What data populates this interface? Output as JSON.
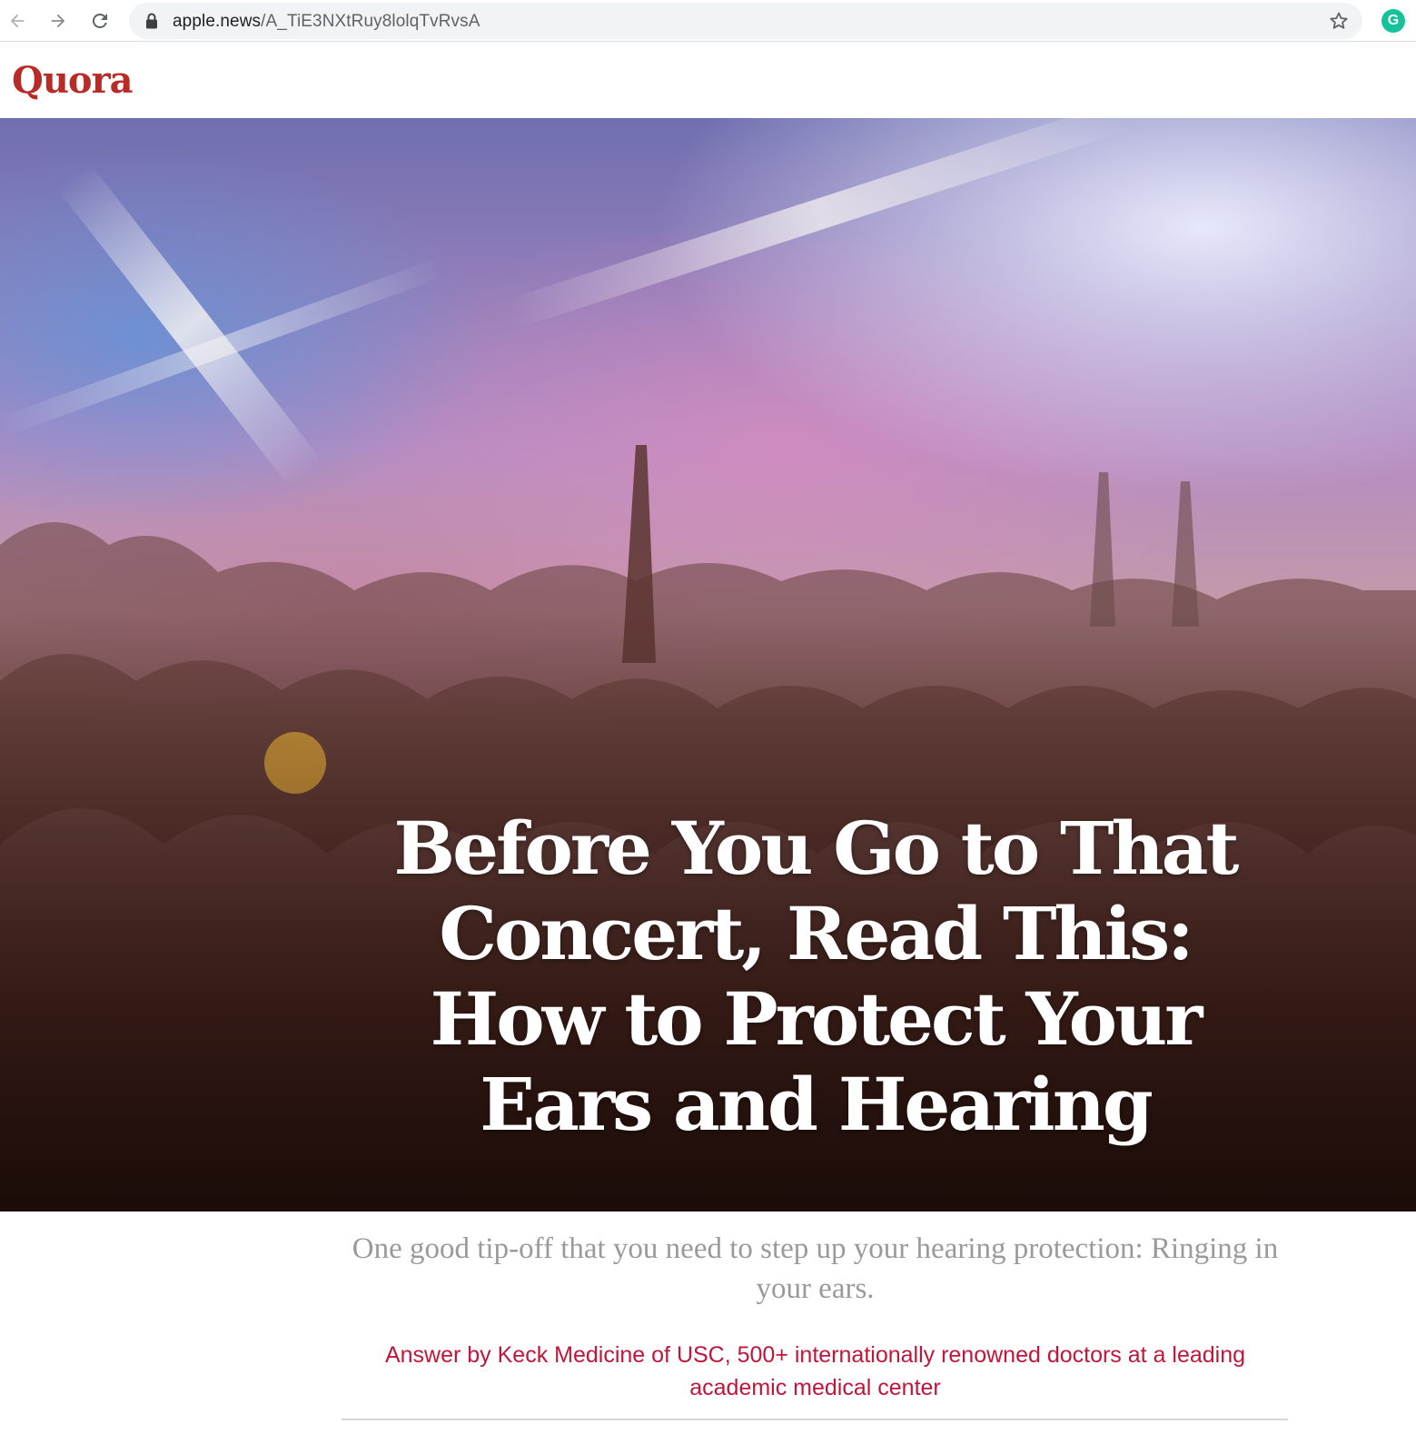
{
  "browser": {
    "url_domain": "apple.news",
    "url_path": "/A_TiE3NXtRuy8lolqTvRvsA",
    "extension_label": "G"
  },
  "publisher": {
    "logo_text": "Quora",
    "brand_color": "#b92b27"
  },
  "article": {
    "title": "Before You Go to That Concert, Read This: How to Protect Your Ears and Hearing",
    "subtitle": "One good tip-off that you need to step up your hearing protection: Ringing in your ears.",
    "byline": "Answer by Keck Medicine of USC, 500+ internationally renowned doctors at a leading academic medical center",
    "byline_color": "#c0163a"
  },
  "icons": {
    "back": "arrow-left-icon",
    "forward": "arrow-right-icon",
    "reload": "reload-icon",
    "lock": "lock-icon",
    "bookmark": "star-icon",
    "extension": "grammarly-icon"
  }
}
